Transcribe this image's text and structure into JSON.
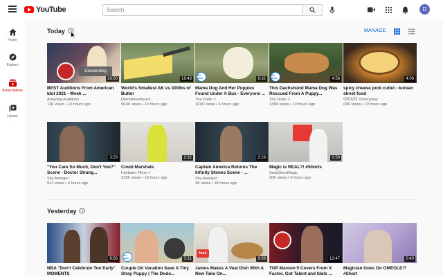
{
  "header": {
    "logo_text": "YouTube",
    "search_placeholder": "Search",
    "avatar_letter": "D"
  },
  "sidebar": {
    "items": [
      {
        "label": "Home",
        "icon": "home-icon"
      },
      {
        "label": "Explore",
        "icon": "compass-icon"
      },
      {
        "label": "Subscriptions",
        "icon": "subscriptions-icon",
        "active": true
      },
      {
        "label": "Library",
        "icon": "library-icon"
      }
    ]
  },
  "main": {
    "sections": [
      {
        "title": "Today"
      },
      {
        "title": "Yesterday"
      }
    ],
    "manage_label": "MANAGE",
    "tooltip": "Descending"
  },
  "videos": [
    {
      "title": "BEST Auditions From American Idol 2021 - Week ...",
      "channel": "Amazing Auditions",
      "meta": "11K views • 10 hours ago",
      "duration": "19:50"
    },
    {
      "title": "World's Smallest AK vs 300lbs of Butter",
      "channel": "DemolitionRanch",
      "meta": "904K views • 10 hours ago",
      "duration": "19:43"
    },
    {
      "title": "Mama Dog And Her Puppies Found Under A Bus - Everyone ...",
      "channel": "The Dodo",
      "meta": "101K views • 6 hours ago",
      "duration": "6:32"
    },
    {
      "title": "This Dachshund Mama Dog Was Rescued From A Puppy...",
      "channel": "The Dodo",
      "meta": "135K views • 10 hours ago",
      "duration": "4:58"
    },
    {
      "title": "spicy cheese pork cutlet - korean street food",
      "channel": "야미보이 Yummyboy",
      "meta": "63K views • 10 hours ago",
      "duration": "4:06"
    },
    {
      "title": "\"You Care So Much, Don't You?\" Scene - Doctor Strang...",
      "channel": "Sky Avenger",
      "meta": "912 views • 6 hours ago",
      "duration": "3:23"
    },
    {
      "title": "Covid Marshals",
      "channel": "Fairbairn Films",
      "meta": "219K views • 10 hours ago",
      "duration": "2:32"
    },
    {
      "title": "Captain America Returns The Infinity Stones Scene - ...",
      "channel": "Sky Avenger",
      "meta": "3K views • 18 hours ago",
      "duration": "2:28"
    },
    {
      "title": "Magic is REAL?! #Shorts",
      "channel": "SeanDoesMagic",
      "meta": "30K views • 9 hours ago",
      "duration": "0:59"
    },
    {
      "title": "NBA \"Don't Celebrate Too Early\" MOMENTS",
      "channel": "",
      "meta": "",
      "duration": "9:56"
    },
    {
      "title": "Couple On Vacation Save A Tiny Stray Puppy | The Dodo...",
      "channel": "",
      "meta": "",
      "duration": "3:31"
    },
    {
      "title": "James Makes A Veal Dish With A New Take On...",
      "channel": "",
      "meta": "",
      "duration": "9:39"
    },
    {
      "title": "TOP Maroon 5 Covers From X Factor, Got Talent and Idols ...",
      "channel": "",
      "meta": "",
      "duration": "12:47"
    },
    {
      "title": "Magician Goes On OMEGLE!? #Short",
      "channel": "",
      "meta": "",
      "duration": "0:40"
    }
  ],
  "thumb_labels": {
    "dodo": "the dodo",
    "food": "food"
  },
  "colors": {
    "brand_red": "#ff0000",
    "link_blue": "#065fd4",
    "dodo_blue": "#1e88e5"
  }
}
